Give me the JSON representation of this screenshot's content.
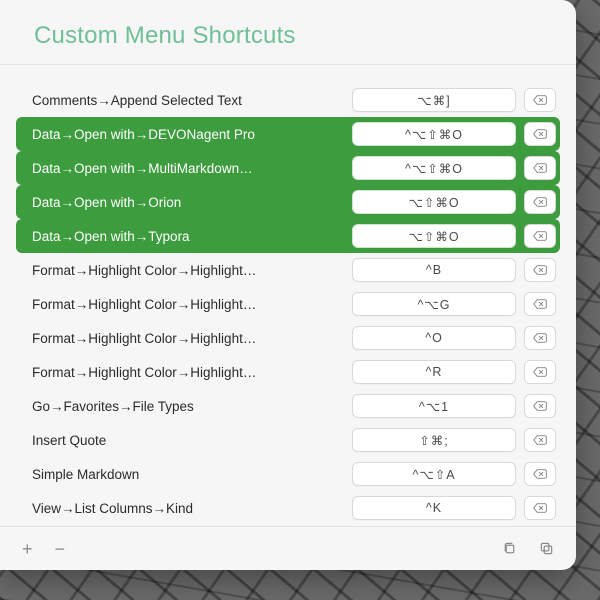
{
  "title": "Custom Menu Shortcuts",
  "rows": [
    {
      "path": "Comments→Append Selected Text",
      "shortcut": "⌥⌘]",
      "selected": false
    },
    {
      "path": "Data→Open with→DEVONagent Pro",
      "shortcut": "^⌥⇧⌘O",
      "selected": true
    },
    {
      "path": "Data→Open with→MultiMarkdown…",
      "shortcut": "^⌥⇧⌘O",
      "selected": true
    },
    {
      "path": "Data→Open with→Orion",
      "shortcut": "⌥⇧⌘O",
      "selected": true
    },
    {
      "path": "Data→Open with→Typora",
      "shortcut": "⌥⇧⌘O",
      "selected": true
    },
    {
      "path": "Format→Highlight Color→Highlight…",
      "shortcut": "^B",
      "selected": false
    },
    {
      "path": "Format→Highlight Color→Highlight…",
      "shortcut": "^⌥G",
      "selected": false
    },
    {
      "path": "Format→Highlight Color→Highlight…",
      "shortcut": "^O",
      "selected": false
    },
    {
      "path": "Format→Highlight Color→Highlight…",
      "shortcut": "^R",
      "selected": false
    },
    {
      "path": "Go→Favorites→File Types",
      "shortcut": "^⌥1",
      "selected": false
    },
    {
      "path": "Insert Quote",
      "shortcut": "⇧⌘;",
      "selected": false
    },
    {
      "path": "Simple Markdown",
      "shortcut": "^⌥⇧A",
      "selected": false
    },
    {
      "path": "View→List Columns→Kind",
      "shortcut": "^K",
      "selected": false
    }
  ],
  "footer": {
    "add_label": "+",
    "remove_label": "−"
  }
}
